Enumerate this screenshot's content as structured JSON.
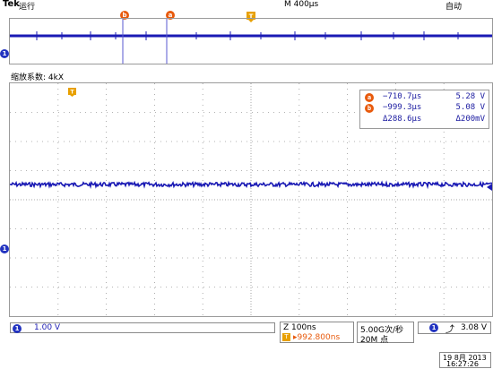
{
  "header": {
    "brand": "Tek",
    "run_state": "运行",
    "timebase": "M 400µs",
    "trigger_mode": "自动"
  },
  "overview": {
    "channel_marker": "1",
    "cursor_b_label": "b",
    "cursor_a_label": "a",
    "trigger_marker": "T"
  },
  "zoom_factor_label": "缩放系数: 4kX",
  "measurement": {
    "a_time": "−710.7µs",
    "a_volt": "5.28 V",
    "b_time": "−999.3µs",
    "b_volt": "5.08 V",
    "delta_time": "Δ288.6µs",
    "delta_volt": "Δ200mV"
  },
  "bottom": {
    "ch1_scale": "1.00 V",
    "zoom_time": "Z 100ns",
    "zoom_offset": "▸992.800ns",
    "sample_rate": "5.00G次/秒",
    "record_length": "20M 点",
    "trig_channel": "1",
    "trig_level": "3.08 V",
    "date": "19 8月  2013",
    "time": "16:27:26"
  },
  "colors": {
    "trace": "#1a1ab4",
    "cursor": "#5a5ad0",
    "accent_orange": "#e85a0c",
    "grid": "#9a9a9a"
  }
}
